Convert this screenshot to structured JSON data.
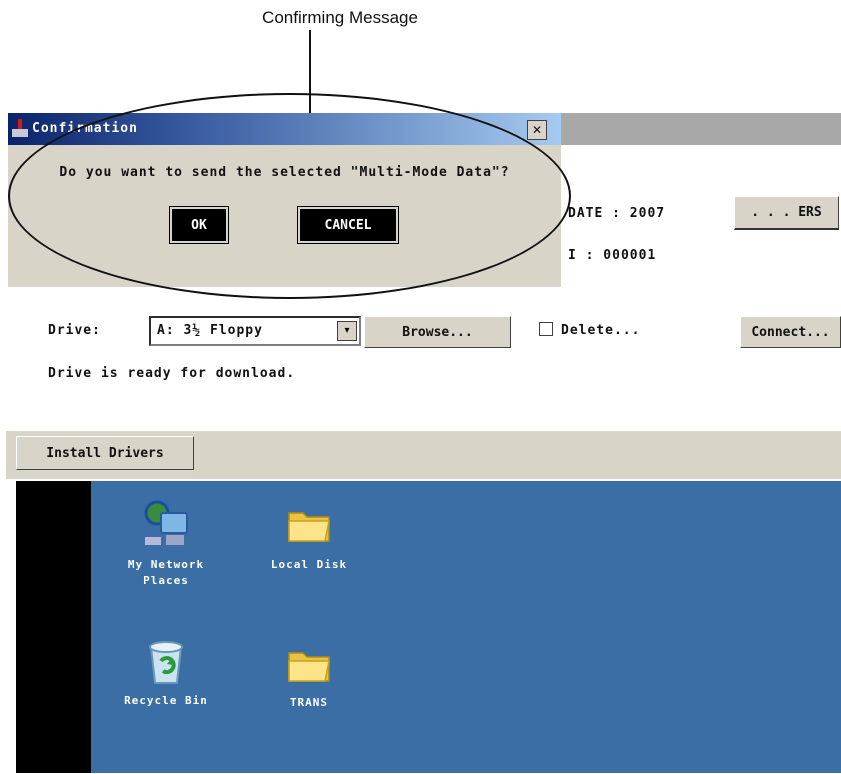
{
  "annotation": {
    "title": "Confirming Message"
  },
  "dialog": {
    "title": "Confirmation",
    "close_glyph": "✕",
    "message": "Do you want to send the selected \"Multi-Mode Data\"?",
    "ok_label": "OK",
    "cancel_label": "CANCEL",
    "app_icon": "app-icon"
  },
  "main": {
    "field_top": "DATE : 2007",
    "button_top": ". . . ERS",
    "field_second": "I : 000001",
    "drive_label": "Drive:",
    "drive_select": "A: 3½ Floppy",
    "drive_select_arrow": "▾",
    "browse_button": "Browse...",
    "checkbox_label": "Delete...",
    "right_button": "Connect...",
    "status_line": "Drive is ready for download.",
    "install_tab": "Install Drivers"
  },
  "desktop": {
    "bg_color": "#3a6ea5",
    "icons": [
      {
        "label": "My Network",
        "label2": "Places",
        "icon": "network-places-icon"
      },
      {
        "label": "Local Disk",
        "label2": "",
        "icon": "folder-icon"
      },
      {
        "label": "Recycle Bin",
        "label2": "",
        "icon": "recycle-bin-icon"
      },
      {
        "label": "TRANS",
        "label2": "",
        "icon": "folder-icon"
      }
    ]
  }
}
